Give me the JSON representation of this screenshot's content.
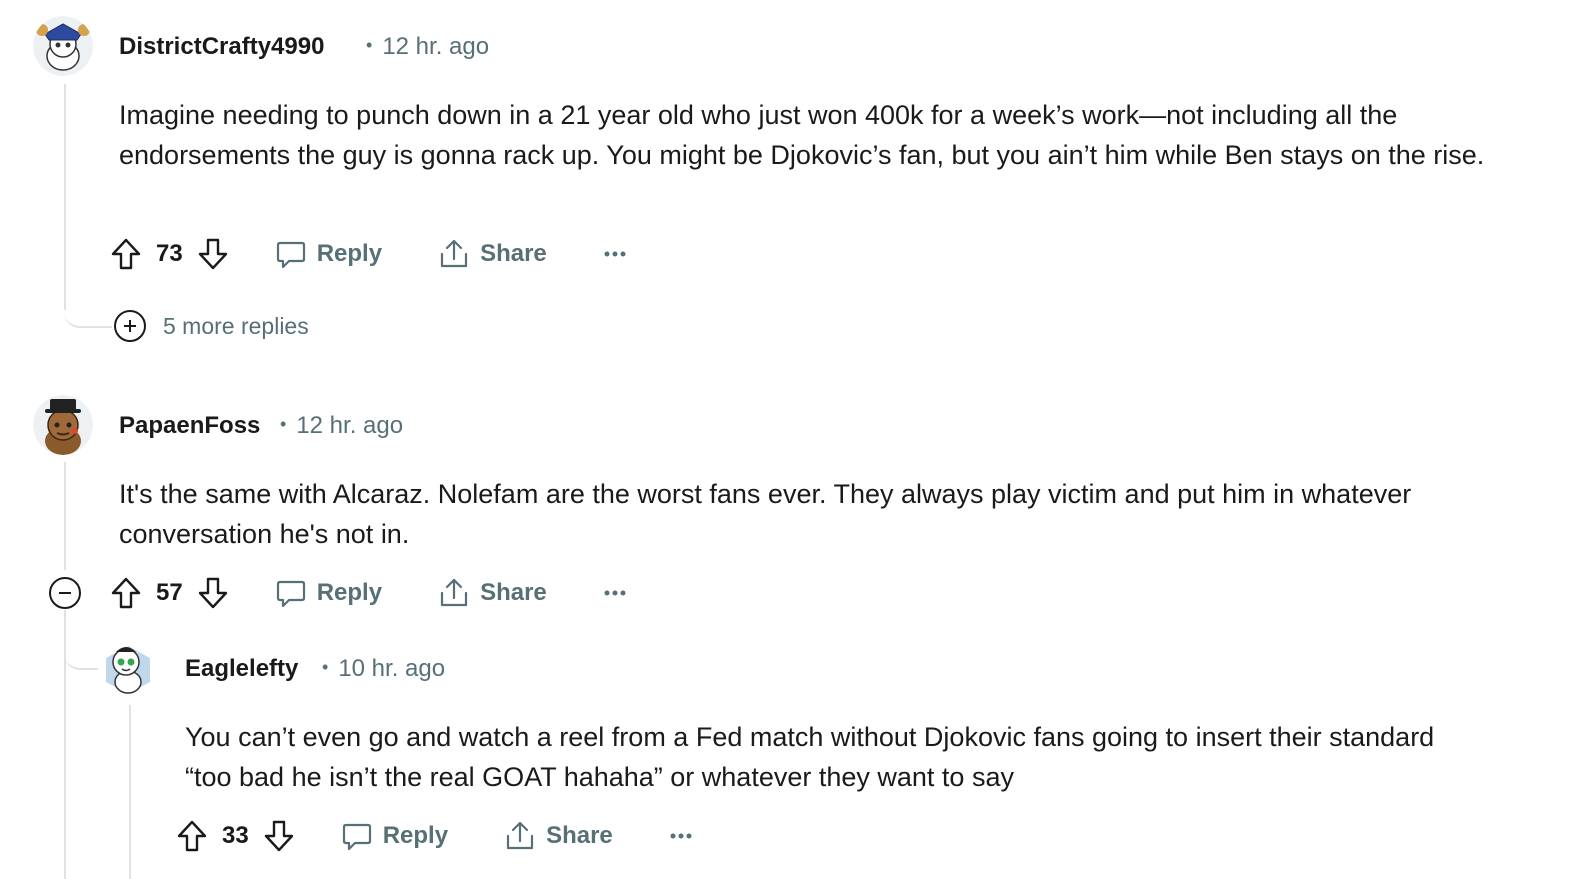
{
  "comments": [
    {
      "username": "DistrictCrafty4990",
      "time": "12 hr. ago",
      "body": "Imagine needing to punch down in a 21 year old who just won 400k for a week’s work—not including all the endorsements the guy is gonna rack up. You might be Djokovic’s fan, but you ain’t him while Ben stays on the rise.",
      "votes": "73",
      "reply_label": "Reply",
      "share_label": "Share",
      "more_replies": "5 more replies"
    },
    {
      "username": "PapaenFoss",
      "time": "12 hr. ago",
      "body": "It's the same with Alcaraz. Nolefam are the worst fans ever. They always play victim and put him in whatever conversation he's not in.",
      "votes": "57",
      "reply_label": "Reply",
      "share_label": "Share"
    },
    {
      "username": "Eaglelefty",
      "time": "10 hr. ago",
      "body": "You can’t even go and watch a reel from a Fed match without Djokovic fans going to insert their standard “too bad he isn’t the real GOAT hahaha” or whatever they want to say",
      "votes": "33",
      "reply_label": "Reply",
      "share_label": "Share"
    }
  ],
  "meta_separator": "•",
  "icons": {
    "upvote": "arrow-up-icon",
    "downvote": "arrow-down-icon",
    "reply": "speech-bubble-icon",
    "share": "share-upload-icon",
    "more": "ellipsis-icon",
    "expand": "plus-circle-icon",
    "collapse": "minus-circle-icon"
  },
  "colors": {
    "text": "#1a1a1b",
    "meta": "#576f76",
    "thread_line": "#dfe1e3"
  }
}
